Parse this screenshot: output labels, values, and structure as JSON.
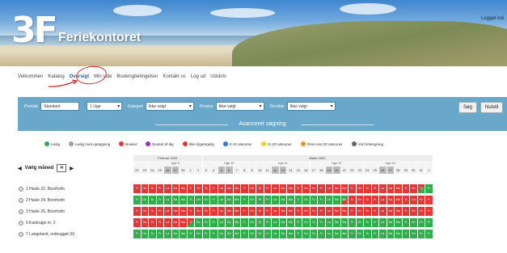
{
  "header": {
    "logo_mark": "3F",
    "title": "Feriekontoret",
    "login_label": "Logget ind"
  },
  "nav": {
    "items": [
      {
        "label": "Velkommen",
        "active": false
      },
      {
        "label": "Katalog",
        "active": false
      },
      {
        "label": "Oversigt",
        "active": true
      },
      {
        "label": "Min side",
        "active": false
      },
      {
        "label": "Bookingbetingelser",
        "active": false
      },
      {
        "label": "Kontakt os",
        "active": false
      },
      {
        "label": "Log ud",
        "active": false
      },
      {
        "label": "Udskriv",
        "active": false
      }
    ]
  },
  "filters": {
    "period_label": "Periode",
    "period_value": "Standard",
    "week_value": "1 Uge",
    "category_label": "Kategori",
    "category_value": "Ikke valgt",
    "province_label": "Provins",
    "province_value": "Ikke valgt",
    "region_label": "Område",
    "region_value": "Ikke valgt",
    "search_button": "Søg",
    "reset_button": "Nulstil",
    "advanced_label": "Avanceret søgning"
  },
  "legend": [
    {
      "label": "Ledig",
      "color": "#2faf4a"
    },
    {
      "label": "Ledig med opsøgning",
      "color": "#a0a0a0"
    },
    {
      "label": "Booket",
      "color": "#e53535"
    },
    {
      "label": "Booket af dig",
      "color": "#9b2fb0"
    },
    {
      "label": "Ikke tilgængelig",
      "color": "#e53535"
    },
    {
      "label": "0-10 sæsoner",
      "color": "#2f78d0"
    },
    {
      "label": "11-20 sæsoner",
      "color": "#f0d020"
    },
    {
      "label": "Flere end 20 sæsoner",
      "color": "#f09020"
    },
    {
      "label": "Via forlængning",
      "color": "#666666"
    }
  ],
  "month_picker": {
    "label": "Vælg måned",
    "prev_icon": "chevron-left-icon",
    "next_icon": "chevron-right-icon"
  },
  "calendar": {
    "months": [
      {
        "label": "Februar 2020",
        "span": 9
      },
      {
        "label": "Marts 2020",
        "span": 30
      }
    ],
    "weeks": [
      {
        "label": "",
        "span": 2
      },
      {
        "label": "Uge 9",
        "span": 7
      },
      {
        "label": "Uge 10",
        "span": 7
      },
      {
        "label": "Uge 11",
        "span": 7
      },
      {
        "label": "Uge 12",
        "span": 7
      },
      {
        "label": "Uge 13",
        "span": 7
      },
      {
        "label": "",
        "span": 2
      }
    ],
    "days": [
      "22",
      "23",
      "24",
      "25",
      "26",
      "27",
      "28",
      "1",
      "2",
      "3",
      "4",
      "5",
      "6",
      "7",
      "8",
      "9",
      "10",
      "11",
      "12",
      "13",
      "14",
      "15",
      "16",
      "17",
      "18",
      "19",
      "20",
      "21",
      "22",
      "23",
      "24",
      "25",
      "26",
      "27",
      "28",
      "29",
      "30",
      "31",
      "1"
    ],
    "weekend_index": [
      4,
      5,
      11,
      12,
      18,
      19,
      25,
      26,
      32,
      33
    ]
  },
  "units": [
    {
      "name": "1 Hasle 22, Bornholm",
      "pattern": "rrrrrrrrrrrrrrrrrrrrrrrrrrrrrrrrrrrrrXgggg"
    },
    {
      "name": "2 Hasle 24, Bornholm",
      "pattern": "gggggggggggggggggggggggggggYrrrrrrrrrrrrrrrrrrr"
    },
    {
      "name": "3 Hasle 26, Bornholm",
      "pattern": "rrrrrrrrrrrrrrrrrrrrrrrrrrrrrrrrrrrrrrrrrrrr"
    },
    {
      "name": "5 Kastrupje nr. 3",
      "pattern": "rrrrrrrXggggggggggggggggggggggggggggggggggg"
    },
    {
      "name": "7 Langeland, ordnugget (6)",
      "pattern": "ggggggggggggggggggggggggggggggggggggggg"
    }
  ]
}
